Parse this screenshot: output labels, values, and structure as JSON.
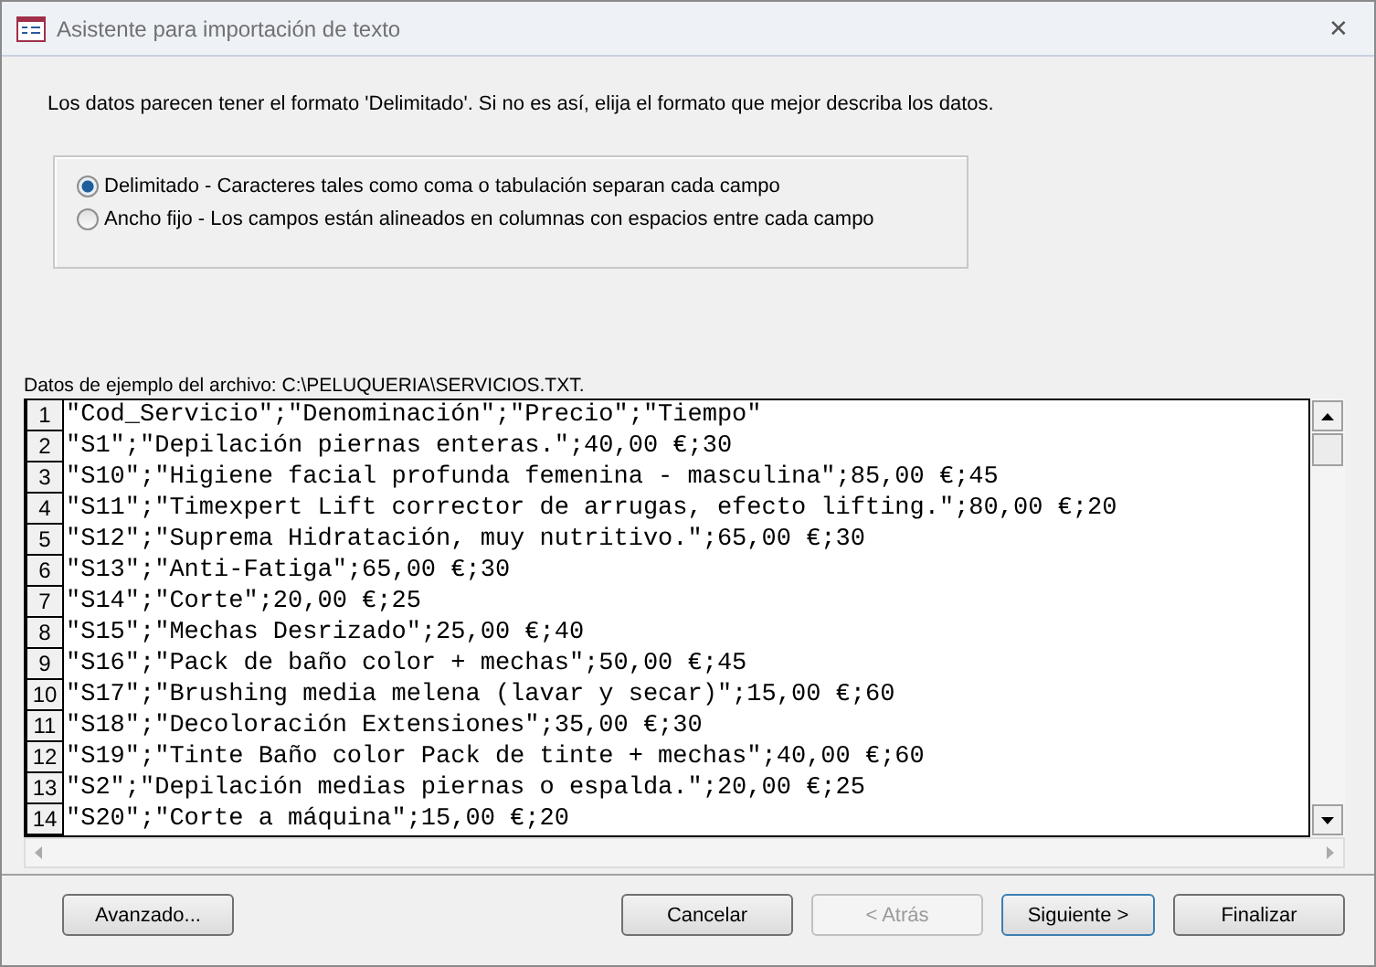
{
  "window": {
    "title": "Asistente para importación de texto",
    "close": "✕"
  },
  "intro": "Los datos parecen tener el formato 'Delimitado'. Si no es así, elija el formato que mejor describa los datos.",
  "format_options": [
    {
      "label": "Delimitado - Caracteres tales como coma o tabulación separan cada campo",
      "selected": true
    },
    {
      "label": "Ancho fijo - Los campos están alineados en columnas con espacios entre cada campo",
      "selected": false
    }
  ],
  "sample_label": "Datos de ejemplo del archivo: C:\\PELUQUERIA\\SERVICIOS.TXT.",
  "sample_lines": [
    {
      "number": "1",
      "text": "\"Cod_Servicio\";\"Denominación\";\"Precio\";\"Tiempo\""
    },
    {
      "number": "2",
      "text": "\"S1\";\"Depilación piernas enteras.\";40,00 €;30"
    },
    {
      "number": "3",
      "text": "\"S10\";\"Higiene facial profunda femenina - masculina\";85,00 €;45"
    },
    {
      "number": "4",
      "text": "\"S11\";\"Timexpert Lift corrector de arrugas, efecto lifting.\";80,00 €;20"
    },
    {
      "number": "5",
      "text": "\"S12\";\"Suprema Hidratación, muy nutritivo.\";65,00 €;30"
    },
    {
      "number": "6",
      "text": "\"S13\";\"Anti-Fatiga\";65,00 €;30"
    },
    {
      "number": "7",
      "text": "\"S14\";\"Corte\";20,00 €;25"
    },
    {
      "number": "8",
      "text": "\"S15\";\"Mechas Desrizado\";25,00 €;40"
    },
    {
      "number": "9",
      "text": "\"S16\";\"Pack de baño color + mechas\";50,00 €;45"
    },
    {
      "number": "10",
      "text": "\"S17\";\"Brushing media melena (lavar y secar)\";15,00 €;60"
    },
    {
      "number": "11",
      "text": "\"S18\";\"Decoloración Extensiones\";35,00 €;30"
    },
    {
      "number": "12",
      "text": "\"S19\";\"Tinte Baño color Pack de tinte + mechas\";40,00 €;60"
    },
    {
      "number": "13",
      "text": "\"S2\";\"Depilación medias piernas o espalda.\";20,00 €;25"
    },
    {
      "number": "14",
      "text": "\"S20\";\"Corte a máquina\";15,00 €;20"
    }
  ],
  "buttons": [
    {
      "label": "Avanzado...",
      "disabled": false,
      "default": false
    },
    {
      "label": "Cancelar",
      "disabled": false,
      "default": false
    },
    {
      "label": "< Atrás",
      "disabled": true,
      "default": false
    },
    {
      "label": "Siguiente >",
      "disabled": false,
      "default": true
    },
    {
      "label": "Finalizar",
      "disabled": false,
      "default": false
    }
  ]
}
